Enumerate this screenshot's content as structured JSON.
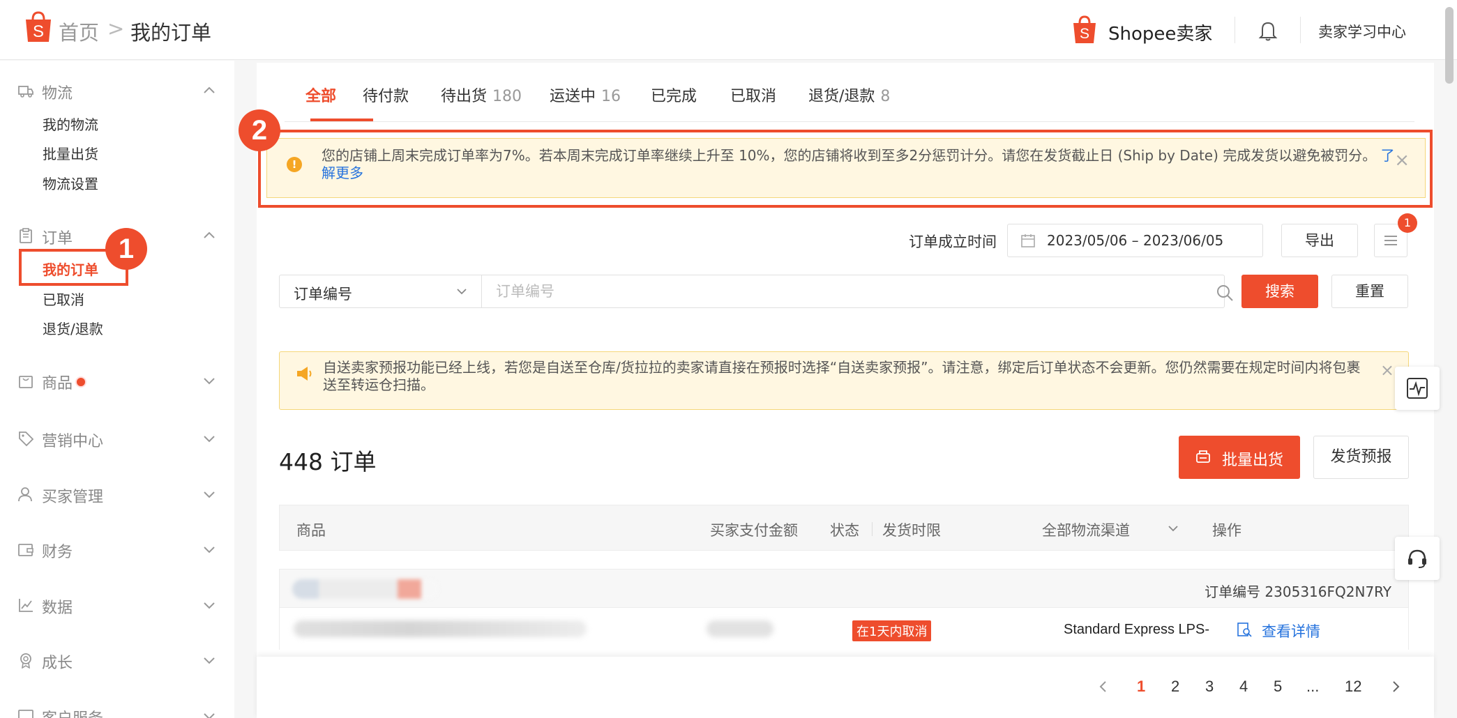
{
  "header": {
    "breadcrumb_home": "首页",
    "breadcrumb_sep": ">",
    "breadcrumb_current": "我的订单",
    "brand": "Shopee卖家",
    "learning_center": "卖家学习中心"
  },
  "sidebar": {
    "logistics": {
      "label": "物流",
      "items": [
        "我的物流",
        "批量出货",
        "物流设置"
      ]
    },
    "orders": {
      "label": "订单",
      "items": [
        "我的订单",
        "已取消",
        "退货/退款"
      ]
    },
    "products": "商品",
    "marketing": "营销中心",
    "buyers": "买家管理",
    "finance": "财务",
    "data": "数据",
    "growth": "成长",
    "support": "客户服务"
  },
  "annotations": {
    "one": "1",
    "two": "2"
  },
  "tabs": [
    {
      "label": "全部",
      "count": ""
    },
    {
      "label": "待付款",
      "count": ""
    },
    {
      "label": "待出货",
      "count": "180"
    },
    {
      "label": "运送中",
      "count": "16"
    },
    {
      "label": "已完成",
      "count": ""
    },
    {
      "label": "已取消",
      "count": ""
    },
    {
      "label": "退货/退款",
      "count": "8"
    }
  ],
  "warning": {
    "text": "您的店铺上周末完成订单率为7%。若本周末完成订单率继续上升至 10%，您的店铺将收到至多2分惩罚计分。请您在发货截止日 (Ship by Date) 完成发货以避免被罚分。",
    "link": "了解更多"
  },
  "filter": {
    "date_label": "订单成立时间",
    "date_range": "2023/05/06 – 2023/06/05",
    "export": "导出",
    "menu_badge": "1"
  },
  "search": {
    "field": "订单编号",
    "placeholder": "订单编号",
    "search_btn": "搜索",
    "reset_btn": "重置"
  },
  "notice": {
    "text": "自送卖家预报功能已经上线，若您是自送至仓库/货拉拉的卖家请直接在预报时选择“自送卖家预报”。请注意，绑定后订单状态不会更新。您仍然需要在规定时间内将包裹送至转运仓扫描。"
  },
  "orders_summary": {
    "count": "448 订单",
    "bulk_ship": "批量出货",
    "pre_ship": "发货预报"
  },
  "table": {
    "headers": {
      "product": "商品",
      "amount": "买家支付金额",
      "status": "状态",
      "deadline": "发货时限",
      "channel": "全部物流渠道",
      "action": "操作"
    }
  },
  "order": {
    "order_no": "订单编号 2305316FQ2N7RY",
    "status_tag": "在1天内取消",
    "channel": "Standard Express LPS-",
    "detail": "查看详情"
  },
  "pagination": {
    "pages": [
      "1",
      "2",
      "3",
      "4",
      "5",
      "...",
      "12"
    ],
    "current": "1"
  },
  "colors": {
    "accent": "#ee4d2d",
    "link": "#2673dd",
    "warning_bg": "#fff7e1"
  }
}
